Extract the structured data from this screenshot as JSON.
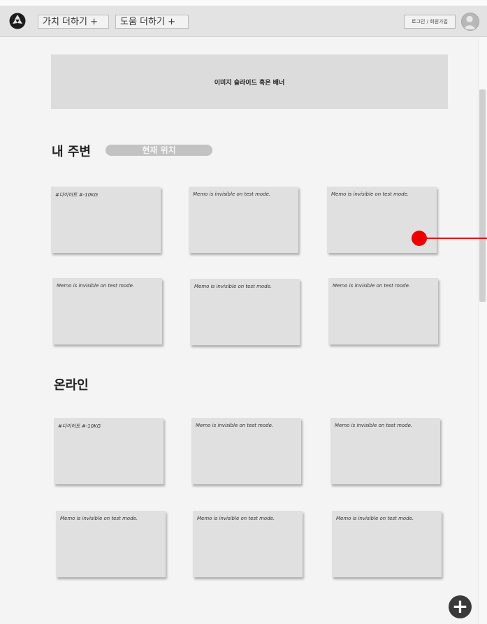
{
  "header": {
    "nav": [
      "가치 더하기 +",
      "도움 더하기 +"
    ],
    "login_label": "로그인 / 회원가입"
  },
  "banner": {
    "text": "이미지 슬라이드 혹은 배너"
  },
  "nearby": {
    "title": "내 주변",
    "location_label": "현재 위치",
    "cards": [
      "#다이어트 #-10KG",
      "Memo is invisible on test mode.",
      "Memo is invisible on test mode.",
      "Memo is invisible on test mode.",
      "Memo is invisible on test mode.",
      "Memo is invisible on test mode."
    ]
  },
  "online": {
    "title": "온라인",
    "cards": [
      "#다이어트 #-10KG",
      "Memo is invisible on test mode.",
      "Memo is invisible on test mode.",
      "Memo is invisible on test mode.",
      "Memo is invisible on test mode.",
      "Memo is invisible on test mode."
    ]
  },
  "fab": {
    "symbol": "+"
  },
  "colors": {
    "pointer": "#ee0000"
  }
}
